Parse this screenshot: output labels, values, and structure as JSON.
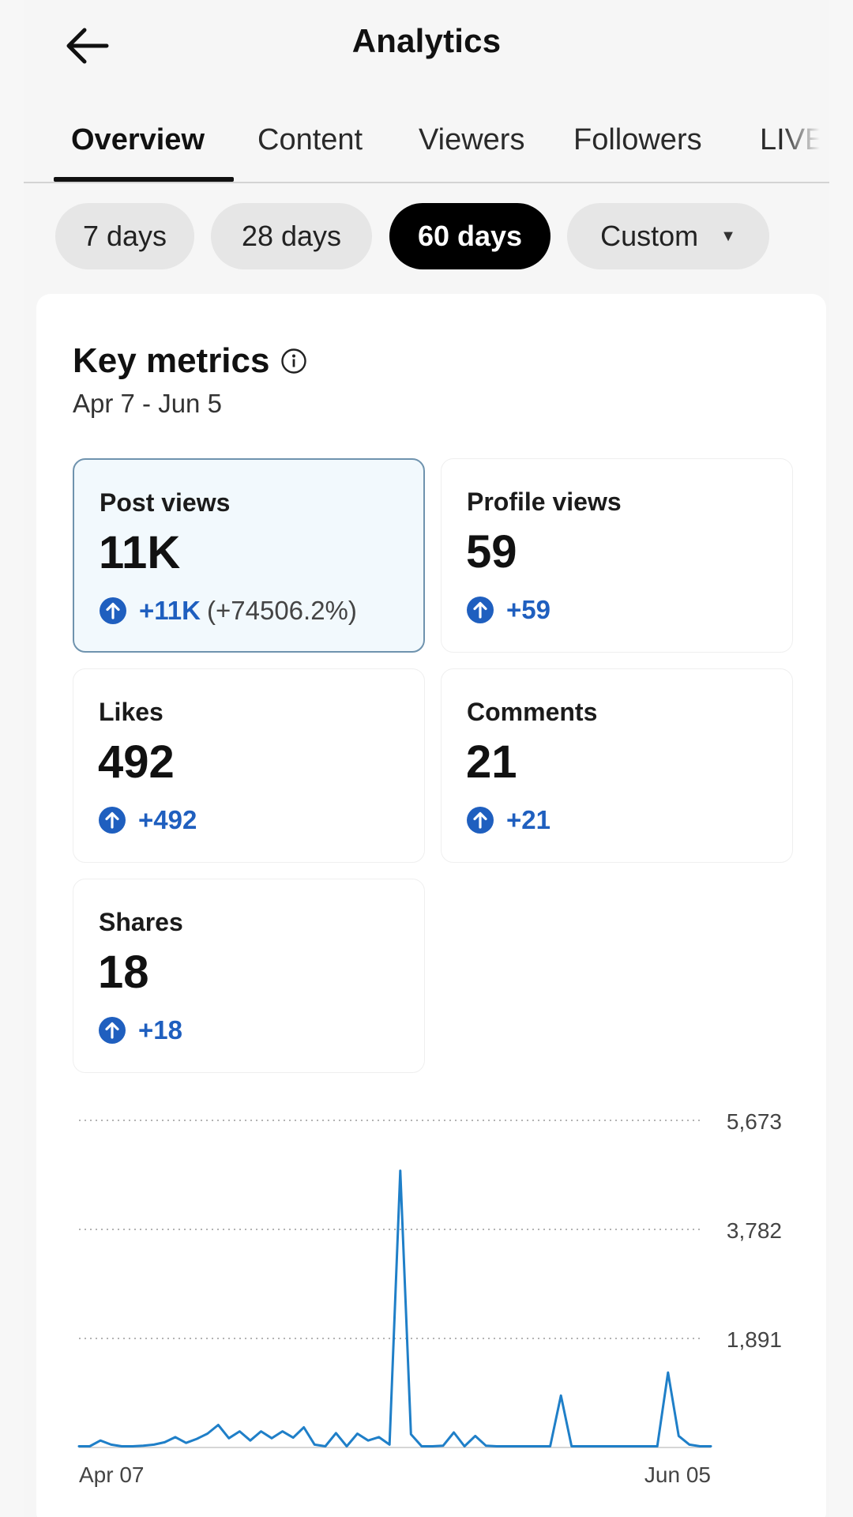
{
  "header": {
    "title": "Analytics",
    "back_icon": "arrow-left-icon"
  },
  "tabs": [
    {
      "label": "Overview",
      "active": true
    },
    {
      "label": "Content"
    },
    {
      "label": "Viewers"
    },
    {
      "label": "Followers"
    },
    {
      "label": "LIVE"
    }
  ],
  "date_filters": [
    {
      "label": "7 days"
    },
    {
      "label": "28 days"
    },
    {
      "label": "60 days",
      "active": true
    },
    {
      "label": "Custom",
      "icon": "caret-down-icon"
    }
  ],
  "key_metrics": {
    "title": "Key metrics",
    "info_icon": "info-icon",
    "range": "Apr 7 - Jun 5",
    "metrics": [
      {
        "label": "Post views",
        "value": "11K",
        "change": "+11K",
        "change_pct": "(+74506.2%)",
        "selected": true
      },
      {
        "label": "Profile views",
        "value": "59",
        "change": "+59"
      },
      {
        "label": "Likes",
        "value": "492",
        "change": "+492"
      },
      {
        "label": "Comments",
        "value": "21",
        "change": "+21"
      },
      {
        "label": "Shares",
        "value": "18",
        "change": "+18"
      }
    ]
  },
  "colors": {
    "accent": "#1f5fbf",
    "line": "#1f7fc8",
    "selected_bg": "#f2f9fd",
    "selected_border": "#6f93ae"
  },
  "chart_data": {
    "type": "line",
    "x_start_label": "Apr 07",
    "x_end_label": "Jun 05",
    "y_ticks": [
      "5,673",
      "3,782",
      "1,891"
    ],
    "ylim": [
      0,
      5673
    ],
    "grid": true,
    "series": [
      {
        "values": [
          20,
          20,
          120,
          50,
          20,
          20,
          30,
          50,
          90,
          180,
          80,
          150,
          240,
          390,
          160,
          280,
          120,
          280,
          160,
          280,
          170,
          350,
          50,
          20,
          250,
          20,
          240,
          120,
          180,
          50,
          4800,
          230,
          20,
          20,
          30,
          260,
          20,
          200,
          30,
          20,
          20,
          20,
          20,
          20,
          20,
          900,
          20,
          20,
          20,
          20,
          20,
          20,
          20,
          20,
          20,
          1300,
          200,
          50,
          20,
          20
        ]
      }
    ]
  }
}
